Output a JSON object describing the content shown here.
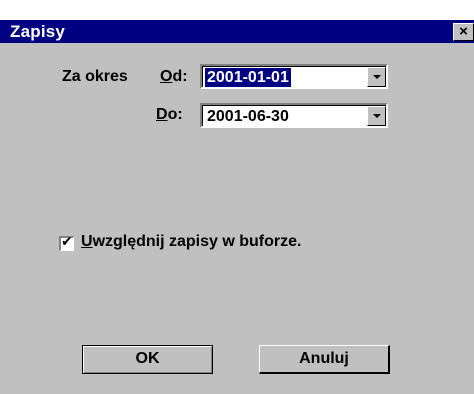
{
  "window": {
    "title": "Zapisy",
    "close_label": "×"
  },
  "period": {
    "label": "Za okres",
    "from_label_mnemonic": "O",
    "from_label_rest": "d:",
    "to_label_mnemonic": "D",
    "to_label_rest": "o:",
    "from_value": "2001-01-01",
    "to_value": "2001-06-30"
  },
  "buffer_option": {
    "checked": true,
    "check_glyph": "✔",
    "label_mnemonic": "U",
    "label_rest": "względnij zapisy w buforze."
  },
  "buttons": {
    "ok": "OK",
    "cancel": "Anuluj"
  },
  "colors": {
    "titlebar": "#000080",
    "face": "#c0c0c0",
    "selection": "#000080"
  },
  "icons": {
    "close": "close-icon",
    "dropdown": "chevron-down-icon",
    "check": "checkmark-icon"
  }
}
